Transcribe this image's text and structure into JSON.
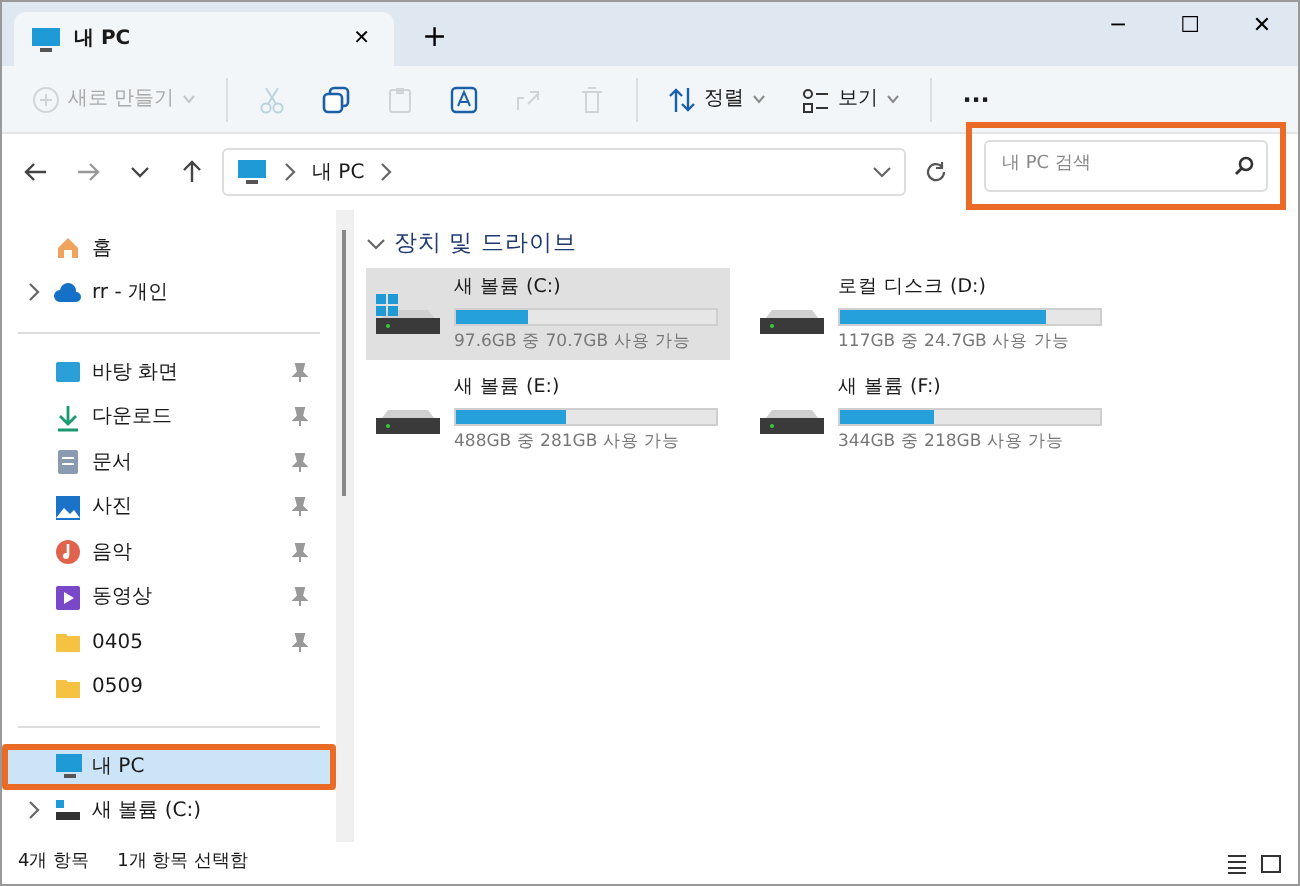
{
  "tabs": [
    {
      "label": "내 PC",
      "selected": true,
      "close": "✕"
    }
  ],
  "new_tab": "+",
  "window_controls": [
    "─",
    "☐",
    "✕"
  ],
  "toolbar": [
    {
      "kind": "new",
      "label": "새로 만들기",
      "disabled": true
    },
    {
      "kind": "cut",
      "disabled": true
    },
    {
      "kind": "copy",
      "disabled": false
    },
    {
      "kind": "paste",
      "disabled": true
    },
    {
      "kind": "rename",
      "disabled": false
    },
    {
      "kind": "share",
      "disabled": true
    },
    {
      "kind": "delete",
      "disabled": true
    },
    {
      "kind": "sort",
      "label": "정렬",
      "disabled": false
    },
    {
      "kind": "view",
      "label": "보기",
      "disabled": false
    },
    {
      "kind": "more",
      "label": "···",
      "disabled": false
    }
  ],
  "address": {
    "path": [
      "내 PC"
    ]
  },
  "search": {
    "placeholder": "내 PC 검색",
    "highlighted": true
  },
  "sidebar": {
    "items": [
      {
        "kind": "home",
        "label": "홈",
        "pinned": false,
        "expandable": false,
        "selected": false,
        "highlighted": false
      },
      {
        "kind": "cloud",
        "label": "rr - 개인",
        "pinned": false,
        "expandable": true,
        "selected": false,
        "highlighted": false
      },
      {
        "kind": "divider"
      },
      {
        "kind": "desktop",
        "label": "바탕 화면",
        "pinned": true,
        "expandable": false,
        "selected": false,
        "highlighted": false
      },
      {
        "kind": "download",
        "label": "다운로드",
        "pinned": true,
        "expandable": false,
        "selected": false,
        "highlighted": false
      },
      {
        "kind": "document",
        "label": "문서",
        "pinned": true,
        "expandable": false,
        "selected": false,
        "highlighted": false
      },
      {
        "kind": "picture",
        "label": "사진",
        "pinned": true,
        "expandable": false,
        "selected": false,
        "highlighted": false
      },
      {
        "kind": "music",
        "label": "음악",
        "pinned": true,
        "expandable": false,
        "selected": false,
        "highlighted": false
      },
      {
        "kind": "video",
        "label": "동영상",
        "pinned": true,
        "expandable": false,
        "selected": false,
        "highlighted": false
      },
      {
        "kind": "folder",
        "label": "0405",
        "pinned": true,
        "expandable": false,
        "selected": false,
        "highlighted": false
      },
      {
        "kind": "folder",
        "label": "0509",
        "pinned": false,
        "expandable": false,
        "selected": false,
        "highlighted": false
      },
      {
        "kind": "divider"
      },
      {
        "kind": "pc",
        "label": "내 PC",
        "pinned": false,
        "expandable": false,
        "selected": true,
        "highlighted": true
      },
      {
        "kind": "drive",
        "label": "새 볼륨 (C:)",
        "pinned": false,
        "expandable": true,
        "selected": false,
        "highlighted": false
      }
    ]
  },
  "section": {
    "title": "장치 및 드라이브",
    "expanded": true
  },
  "drives": [
    {
      "name": "새 볼륨 (C:)",
      "level": 0.28,
      "info": "97.6GB 중 70.7GB 사용 가능",
      "system": true,
      "selected": true
    },
    {
      "name": "로컬 디스크 (D:)",
      "level": 0.79,
      "info": "117GB 중 24.7GB 사용 가능",
      "system": false,
      "selected": false
    },
    {
      "name": "새 볼륨 (E:)",
      "level": 0.42,
      "info": "488GB 중 281GB 사용 가능",
      "system": false,
      "selected": false
    },
    {
      "name": "새 볼륨 (F:)",
      "level": 0.36,
      "info": "344GB 중 218GB 사용 가능",
      "system": false,
      "selected": false
    }
  ],
  "status_bar": {
    "items": [
      "4개 항목",
      "1개 항목 선택함"
    ]
  }
}
